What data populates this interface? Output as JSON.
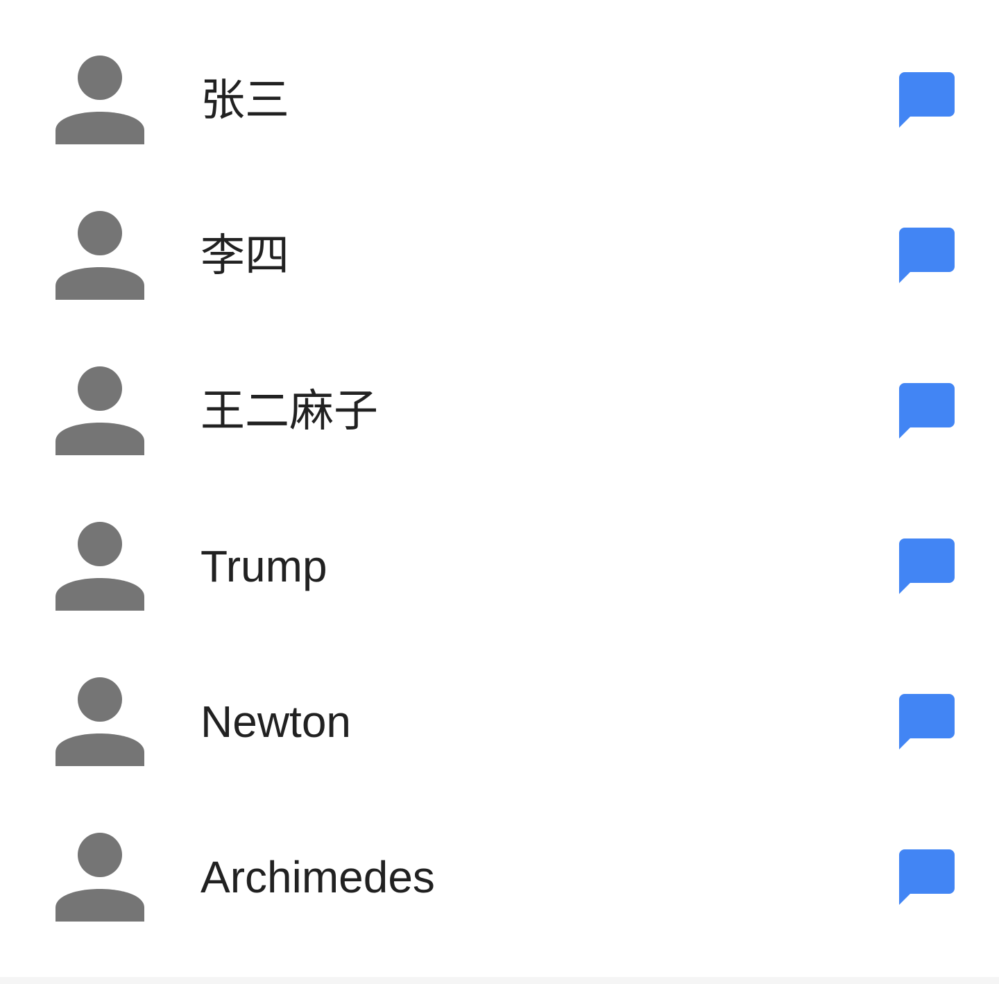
{
  "contacts": [
    {
      "name": "张三",
      "action_icon": "chat-bubble-icon",
      "avatar_icon": "person-icon"
    },
    {
      "name": "李四",
      "action_icon": "chat-bubble-icon",
      "avatar_icon": "person-icon"
    },
    {
      "name": "王二麻子",
      "action_icon": "chat-bubble-icon",
      "avatar_icon": "person-icon"
    },
    {
      "name": "Trump",
      "action_icon": "chat-bubble-icon",
      "avatar_icon": "person-icon"
    },
    {
      "name": "Newton",
      "action_icon": "chat-bubble-icon",
      "avatar_icon": "person-icon"
    },
    {
      "name": "Archimedes",
      "action_icon": "chat-bubble-icon",
      "avatar_icon": "person-icon"
    }
  ],
  "colors": {
    "avatar": "#757575",
    "message_icon": "#4285f4",
    "text": "#212121",
    "background": "#ffffff"
  }
}
